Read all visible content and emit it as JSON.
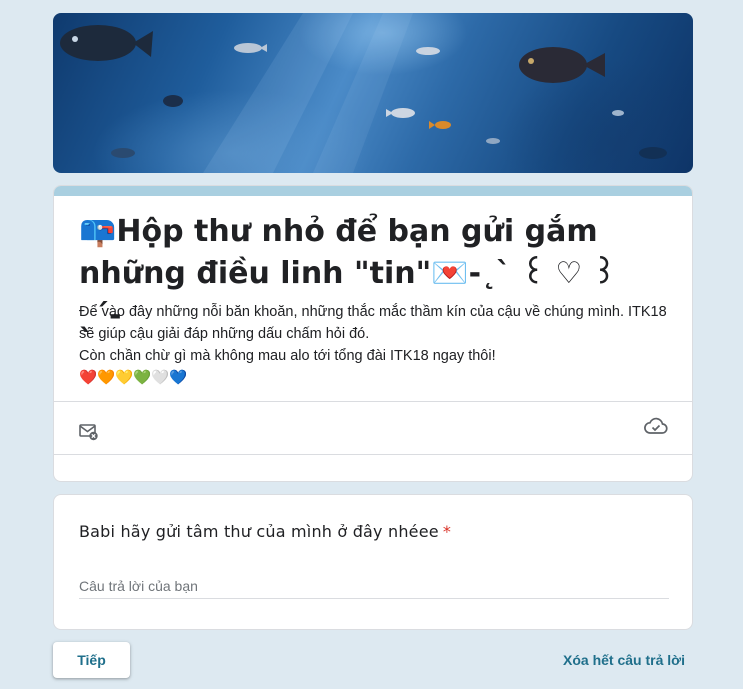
{
  "header": {
    "banner_image": "underwater-fish-banner"
  },
  "form": {
    "title_line1": "📪Hộp thư nhỏ để bạn gửi gắm",
    "title_line2": "những điều linh \"tin\"💌-˛ˋ ꒰ ♡ ꒱ ˎ´-",
    "description_line1": "Để vào đây những nỗi băn khoăn, những thắc mắc thầm kín của cậu về chúng mình. ITK18",
    "description_line2": "sẽ giúp cậu giải đáp những dấu chấm hỏi đó.",
    "description_line3": "Còn chần chừ gì mà không mau alo tới tổng đài ITK18 ngay thôi!",
    "hearts": "❤️🧡💛💚🤍💙",
    "accent_color": "#a9cfe0",
    "icons": {
      "email": "mail-off-icon",
      "cloud": "cloud-done-icon"
    }
  },
  "question": {
    "label": "Babi hãy gửi tâm thư của mình ở đây nhéee",
    "required_mark": "*",
    "placeholder": "Câu trả lời của bạn"
  },
  "actions": {
    "next_label": "Tiếp",
    "clear_label": "Xóa hết câu trả lời"
  }
}
